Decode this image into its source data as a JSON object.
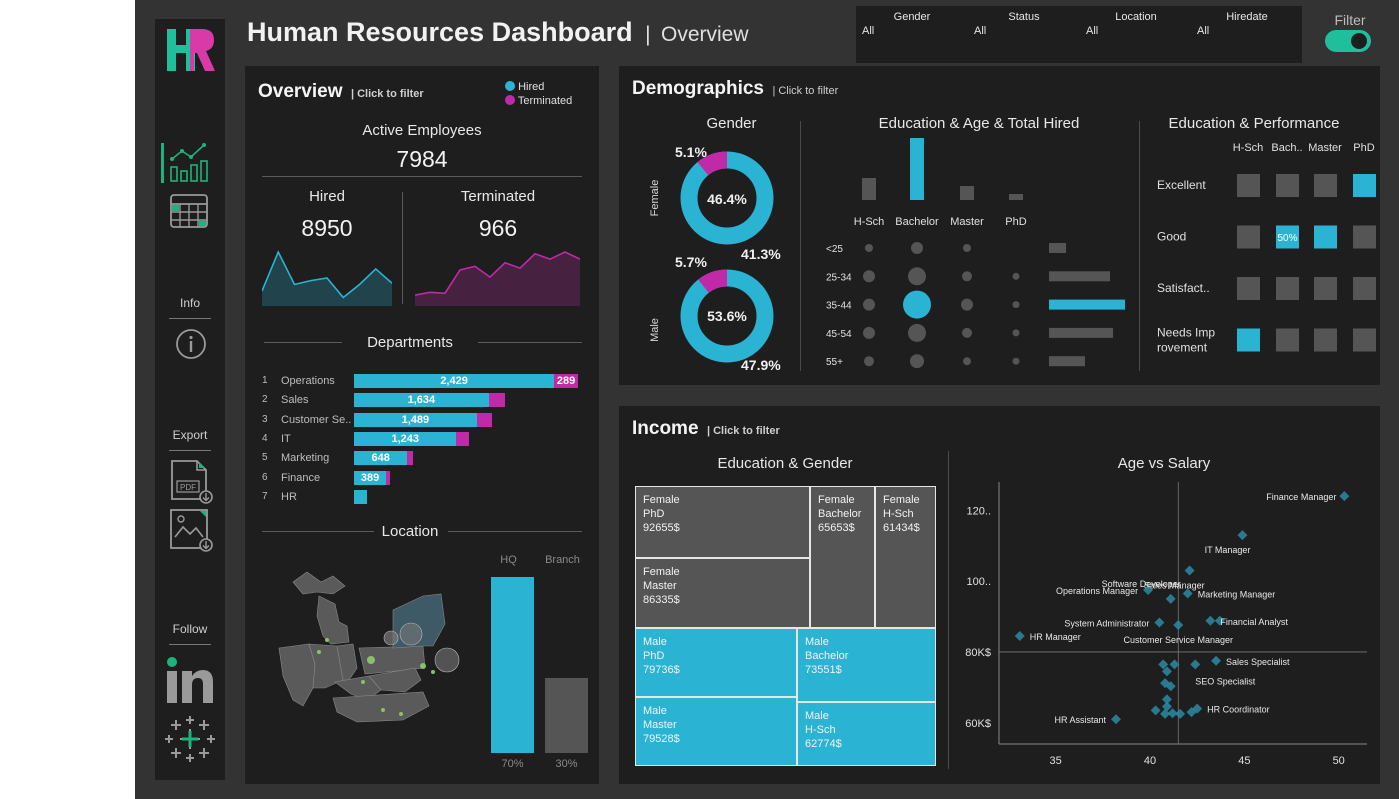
{
  "header": {
    "title": "Human Resources Dashboard",
    "separator": "|",
    "subtitle": "Overview",
    "filters": [
      {
        "label": "Gender",
        "value": "All"
      },
      {
        "label": "Status",
        "value": "All"
      },
      {
        "label": "Location",
        "value": "All"
      },
      {
        "label": "Hiredate",
        "value": "All"
      }
    ],
    "filter_toggle_label": "Filter",
    "filter_toggle_on": true
  },
  "sidebar": {
    "logo_text": "HR",
    "info_label": "Info",
    "export_label": "Export",
    "follow_label": "Follow",
    "pdf_label": "PDF",
    "icons": [
      "dashboard-chart-icon",
      "table-icon",
      "info-icon",
      "pdf-export-icon",
      "image-export-icon",
      "linkedin-icon",
      "tableau-icon"
    ]
  },
  "overview": {
    "title": "Overview",
    "hint": "| Click to filter",
    "legend_hired": "Hired",
    "legend_terminated": "Terminated",
    "active_label": "Active Employees",
    "active_value": "7984",
    "hired_label": "Hired",
    "hired_value": "8950",
    "terminated_label": "Terminated",
    "terminated_value": "966",
    "departments_title": "Departments",
    "location_title": "Location",
    "hq_label": "HQ",
    "branch_label": "Branch",
    "hq_pct": "70%",
    "branch_pct": "30%"
  },
  "colors": {
    "hired": "#2bb3d4",
    "terminated": "#c02aa8",
    "grey": "#555555",
    "green": "#1db37c"
  },
  "demographics": {
    "title": "Demographics",
    "hint": "| Click to filter",
    "gender_title": "Gender",
    "edu_age_title": "Education & Age & Total Hired",
    "edu_perf_title": "Education & Performance",
    "female_label": "Female",
    "male_label": "Male",
    "female_donut": {
      "center": "46.4%",
      "term_pct": "5.1%",
      "hired_pct": "41.3%"
    },
    "male_donut": {
      "center": "53.6%",
      "term_pct": "5.7%",
      "hired_pct": "47.9%"
    },
    "perf_cell_label": "50%"
  },
  "income": {
    "title": "Income",
    "hint": "| Click to filter",
    "treemap_title": "Education & Gender",
    "scatter_title": "Age vs Salary"
  },
  "chart_data": [
    {
      "type": "line",
      "title": "Hired",
      "values": [
        2,
        8,
        3,
        3.6,
        4,
        1,
        3,
        5.4,
        3.2
      ]
    },
    {
      "type": "area",
      "title": "Terminated",
      "values": [
        1,
        1.3,
        1.2,
        3.8,
        4.2,
        3,
        4.6,
        4,
        5.6,
        5,
        5.8,
        5
      ]
    },
    {
      "type": "bar",
      "title": "Departments",
      "categories": [
        "Operations",
        "Sales",
        "Customer Se..",
        "IT",
        "Marketing",
        "Finance",
        "HR"
      ],
      "ranks": [
        "1",
        "2",
        "3",
        "4",
        "5",
        "6",
        "7"
      ],
      "series": [
        {
          "name": "Hired",
          "values": [
            2429,
            1634,
            1489,
            1243,
            648,
            389,
            160
          ],
          "labels": [
            "2,429",
            "1,634",
            "1,489",
            "1,243",
            "648",
            "389",
            ""
          ]
        },
        {
          "name": "Terminated",
          "values": [
            289,
            195,
            180,
            150,
            70,
            50,
            0
          ],
          "labels": [
            "289",
            "",
            "",
            "",
            "",
            "",
            ""
          ]
        }
      ]
    },
    {
      "type": "bar",
      "title": "Location",
      "categories": [
        "HQ",
        "Branch"
      ],
      "values": [
        70,
        30
      ],
      "labels": [
        "70%",
        "30%"
      ]
    },
    {
      "type": "bar",
      "title": "Education & Age & Total Hired",
      "categories": [
        "H-Sch",
        "Bachelor",
        "Master",
        "PhD"
      ],
      "values": [
        22,
        62,
        14,
        6
      ],
      "age_groups": [
        "<25",
        "25-34",
        "35-44",
        "45-54",
        "55+"
      ],
      "bubble_sizes": [
        [
          2,
          4,
          2,
          0
        ],
        [
          4,
          7,
          3,
          1.5
        ],
        [
          4,
          8,
          4,
          1.5
        ],
        [
          4,
          7,
          3,
          1.5
        ],
        [
          3,
          5,
          2,
          1.5
        ]
      ],
      "age_totals": [
        17,
        61,
        76,
        64,
        36
      ]
    },
    {
      "type": "heatmap",
      "title": "Education & Performance",
      "columns": [
        "H-Sch",
        "Bach..",
        "Master",
        "PhD"
      ],
      "rows": [
        "Excellent",
        "Good",
        "Satisfact..",
        "Needs Improvement"
      ],
      "row_labels": [
        [
          "Excellent"
        ],
        [
          "Good"
        ],
        [
          "Satisfact.."
        ],
        [
          "Needs Imp",
          "rovement"
        ]
      ],
      "highlight": [
        [
          0,
          0,
          0,
          1
        ],
        [
          0,
          1,
          1,
          0
        ],
        [
          0,
          0,
          0,
          0
        ],
        [
          1,
          0,
          0,
          0
        ]
      ]
    },
    {
      "type": "table",
      "title": "Education & Gender",
      "cells": [
        {
          "gender": "Female",
          "education": "PhD",
          "salary": "92655$"
        },
        {
          "gender": "Female",
          "education": "Master",
          "salary": "86335$"
        },
        {
          "gender": "Female",
          "education": "Bachelor",
          "salary": "65653$"
        },
        {
          "gender": "Female",
          "education": "H-Sch",
          "salary": "61434$"
        },
        {
          "gender": "Male",
          "education": "PhD",
          "salary": "79736$"
        },
        {
          "gender": "Male",
          "education": "Master",
          "salary": "79528$"
        },
        {
          "gender": "Male",
          "education": "Bachelor",
          "salary": "73551$"
        },
        {
          "gender": "Male",
          "education": "H-Sch",
          "salary": "62774$"
        }
      ]
    },
    {
      "type": "scatter",
      "title": "Age vs Salary",
      "x_ticks": [
        "35",
        "40",
        "45",
        "50"
      ],
      "y_ticks": [
        "120..",
        "100..",
        "80K$",
        "60K$"
      ],
      "xlim": [
        32,
        51.5
      ],
      "ylim": [
        54000,
        128000
      ],
      "labeled_points": [
        {
          "label": "Finance Manager",
          "x": 50.3,
          "y": 124000
        },
        {
          "label": "IT Manager",
          "x": 44.9,
          "y": 113000
        },
        {
          "label": "Sales Manager",
          "x": 42.1,
          "y": 103000
        },
        {
          "label": "Operations Manager",
          "x": 39.9,
          "y": 97500
        },
        {
          "label": "Marketing Manager",
          "x": 42,
          "y": 96500
        },
        {
          "label": "Software Developer",
          "x": 41.1,
          "y": 95000
        },
        {
          "label": "System Administrator",
          "x": 40.5,
          "y": 88300
        },
        {
          "label": "Financial Analyst",
          "x": 43.2,
          "y": 88800
        },
        {
          "label": "HR Manager",
          "x": 33.1,
          "y": 84500
        },
        {
          "label": "Customer Service Manager",
          "x": 41.5,
          "y": 87600
        },
        {
          "label": "Sales Specialist",
          "x": 43.5,
          "y": 77500
        },
        {
          "label": "SEO Specialist",
          "x": 42.4,
          "y": 76500
        },
        {
          "label": "HR Coordinator",
          "x": 42.5,
          "y": 64000
        },
        {
          "label": "HR Assistant",
          "x": 38.2,
          "y": 61000
        }
      ],
      "points": [
        {
          "x": 40.7,
          "y": 76500
        },
        {
          "x": 40.9,
          "y": 74500
        },
        {
          "x": 41.3,
          "y": 76500
        },
        {
          "x": 40.8,
          "y": 71200
        },
        {
          "x": 41.1,
          "y": 70300
        },
        {
          "x": 40.9,
          "y": 66600
        },
        {
          "x": 40.3,
          "y": 63500
        },
        {
          "x": 40.8,
          "y": 62500
        },
        {
          "x": 41.2,
          "y": 62700
        },
        {
          "x": 41.6,
          "y": 62500
        },
        {
          "x": 42.2,
          "y": 63000
        },
        {
          "x": 40.9,
          "y": 64600
        },
        {
          "x": 43.7,
          "y": 88800
        }
      ],
      "ref_x": 41.5,
      "ref_y": 80000
    }
  ]
}
